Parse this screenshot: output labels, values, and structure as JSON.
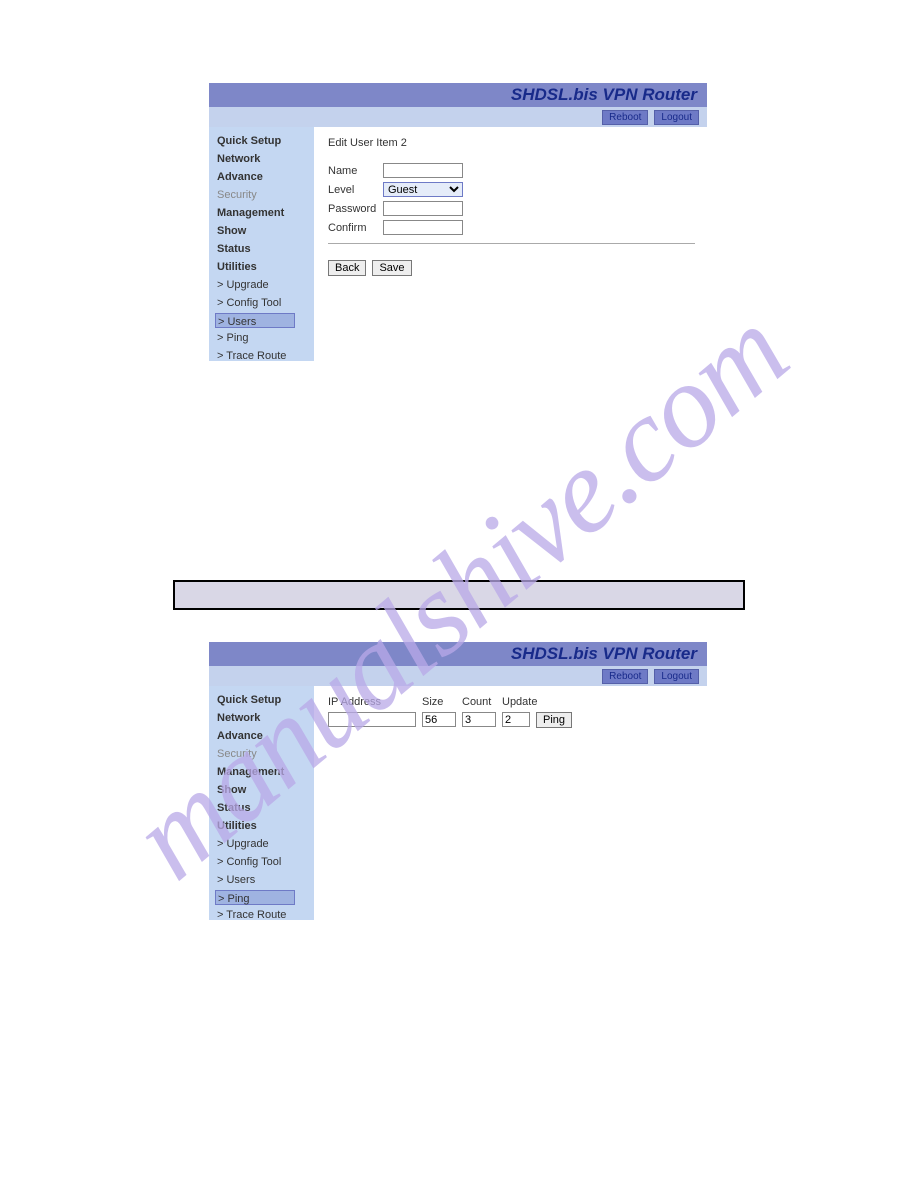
{
  "watermark": "manualshive.com",
  "router_title": "SHDSL.bis VPN Router",
  "toolbar": {
    "reboot": "Reboot",
    "logout": "Logout"
  },
  "sidebar": {
    "items": [
      {
        "label": "Quick Setup",
        "type": "top"
      },
      {
        "label": "Network",
        "type": "top"
      },
      {
        "label": "Advance",
        "type": "top"
      },
      {
        "label": "Security",
        "type": "soft"
      },
      {
        "label": "Management",
        "type": "top"
      },
      {
        "label": "Show",
        "type": "top"
      },
      {
        "label": "Status",
        "type": "top"
      },
      {
        "label": "Utilities",
        "type": "top"
      },
      {
        "label": "> Upgrade",
        "type": "sub"
      },
      {
        "label": "> Config Tool",
        "type": "sub"
      },
      {
        "label": "> Users",
        "type": "sub",
        "sel_in": 1
      },
      {
        "label": "> Ping",
        "type": "sub",
        "sel_in": 2
      },
      {
        "label": "> Trace Route",
        "type": "sub"
      }
    ]
  },
  "panel1": {
    "heading": "Edit User Item 2",
    "fields": {
      "name": "Name",
      "level": "Level",
      "password": "Password",
      "confirm": "Confirm"
    },
    "level_value": "Guest",
    "buttons": {
      "back": "Back",
      "save": "Save"
    }
  },
  "panel2": {
    "cols": {
      "ip": "IP Address",
      "size": "Size",
      "count": "Count",
      "update": "Update"
    },
    "vals": {
      "ip": "",
      "size": "56",
      "count": "3",
      "update": "2"
    },
    "ping_btn": "Ping"
  }
}
